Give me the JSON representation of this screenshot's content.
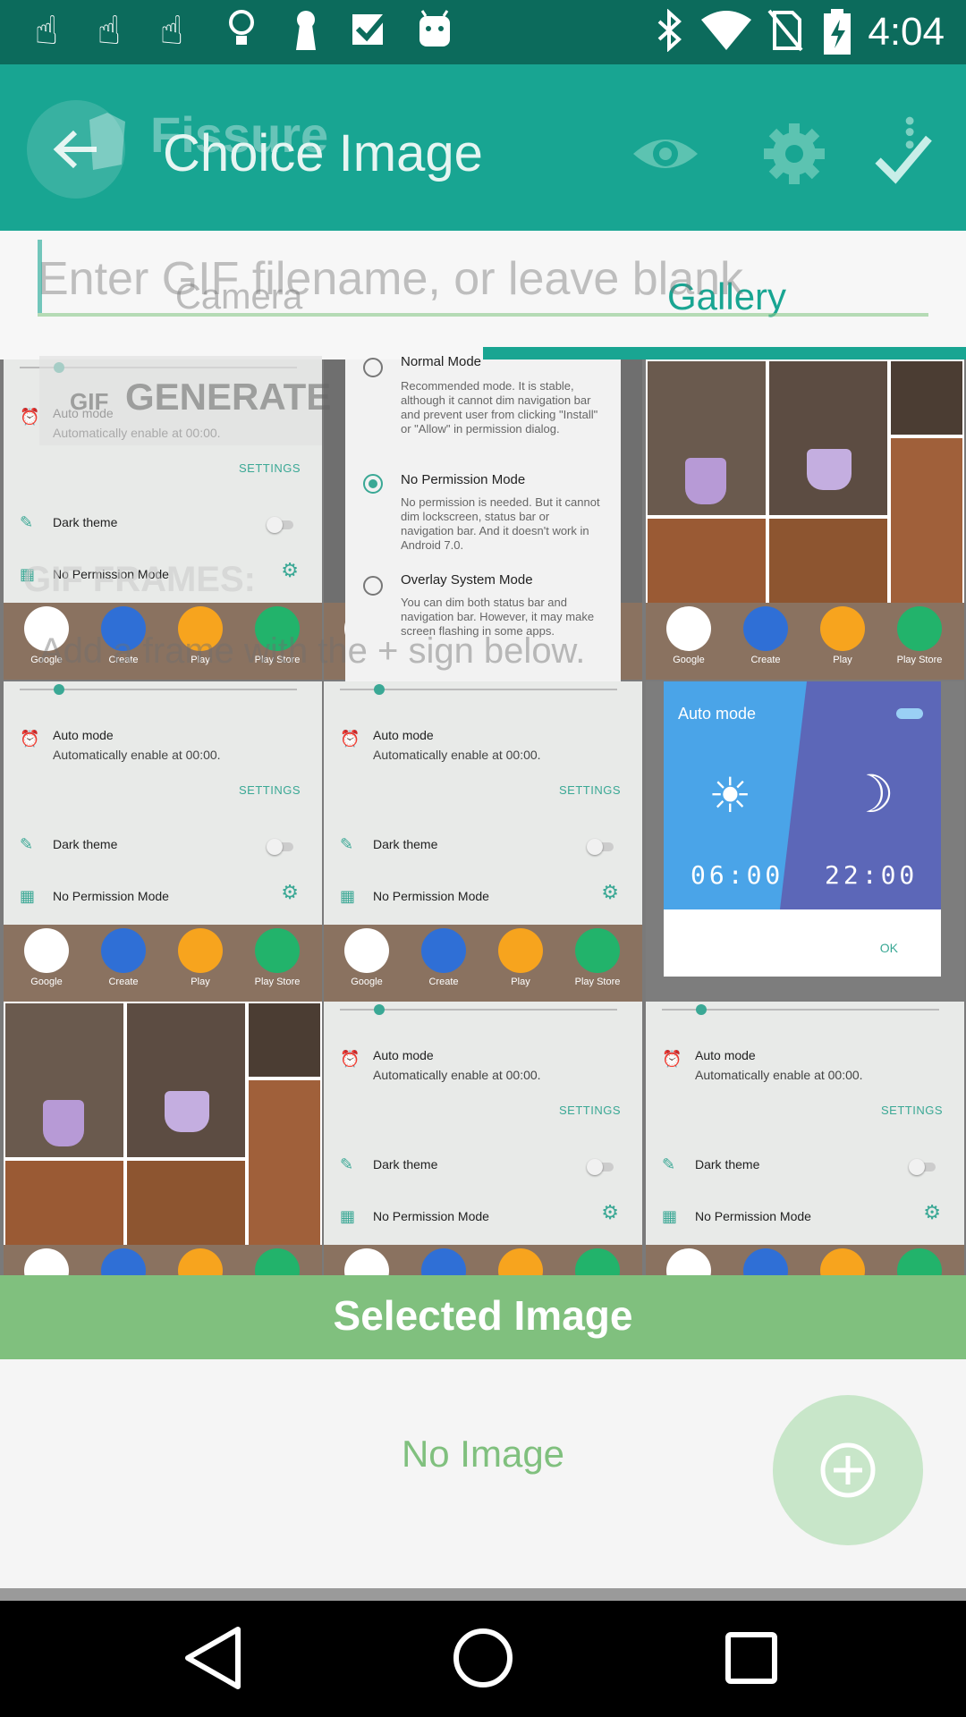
{
  "status_bar": {
    "time": "4:04",
    "left_icons": [
      "hand-icon",
      "hand-icon",
      "hand-icon",
      "lightbulb-icon",
      "keyhole-icon",
      "checkbox-icon",
      "android-icon"
    ],
    "right_icons": [
      "bluetooth-icon",
      "wifi-icon",
      "no-sim-icon",
      "battery-charging-icon"
    ]
  },
  "app_bar": {
    "title": "Choice Image",
    "ghost_title": "Fissure",
    "actions": [
      "eye-icon",
      "gear-icon",
      "check-icon"
    ],
    "color": "#18a592"
  },
  "tabs": {
    "camera": "Camera",
    "gallery": "Gallery",
    "selected": "Gallery"
  },
  "input": {
    "placeholder": "Enter GIF filename, or leave blank",
    "value": ""
  },
  "overlay": {
    "generate": "GENERATE",
    "gif_badge": "GIF",
    "frames_label": "GIF FRAMES:",
    "hint": "Add a frame with the + sign below."
  },
  "settings_shot": {
    "auto_mode": "Auto mode",
    "auto_desc": "Automatically enable at 00:00.",
    "settings": "SETTINGS",
    "dark_theme": "Dark theme",
    "no_permission": "No Permission Mode",
    "apps": [
      "Google",
      "Create",
      "Play",
      "Play Store"
    ]
  },
  "mode_popup": {
    "modes": [
      {
        "title": "Normal Mode",
        "desc": "Recommended mode. It is stable, although it cannot dim navigation bar and prevent user from clicking \"Install\" or \"Allow\" in permission dialog.",
        "selected": false
      },
      {
        "title": "No Permission Mode",
        "desc": "No permission is needed. But it cannot dim lockscreen, status bar or navigation bar. And it doesn't work in Android 7.0.",
        "selected": true
      },
      {
        "title": "Overlay System Mode",
        "desc": "You can dim both status bar and navigation bar. However, it may make screen flashing in some apps.",
        "selected": false
      }
    ]
  },
  "auto_dialog": {
    "title": "Auto mode",
    "day_time": "06:00",
    "night_time": "22:00",
    "ok": "OK"
  },
  "selected": {
    "banner": "Selected Image",
    "empty": "No Image"
  },
  "fab": {
    "icon": "add-circle-icon"
  }
}
